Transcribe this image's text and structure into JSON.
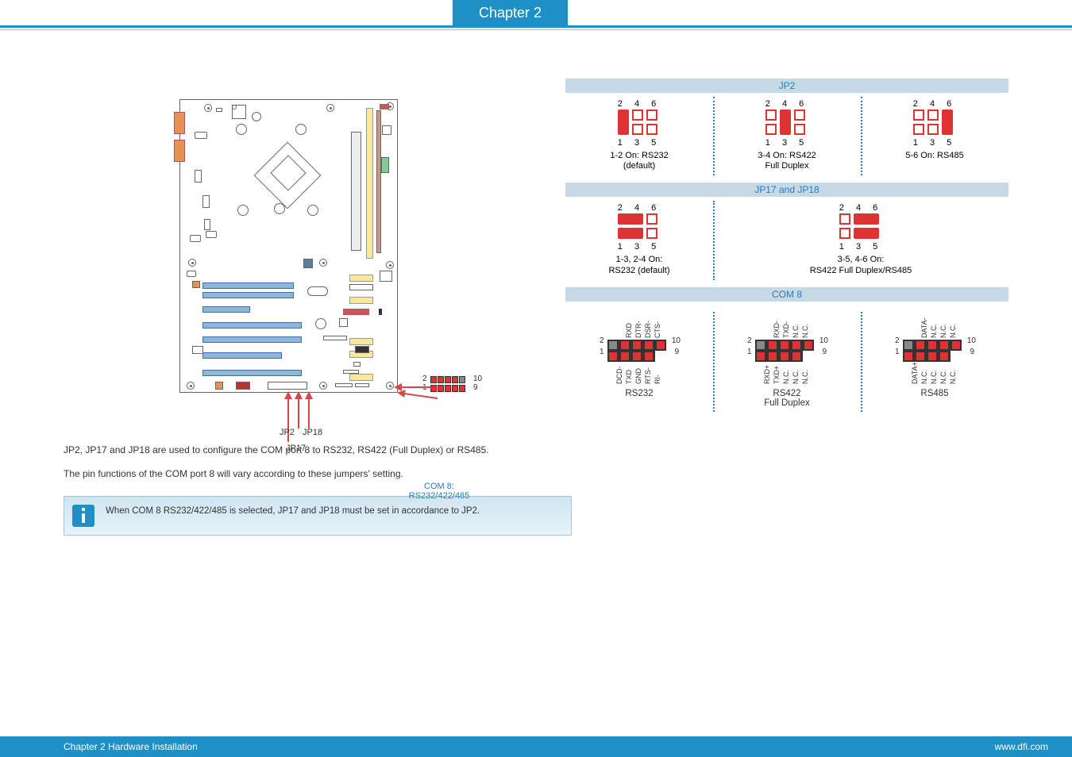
{
  "header": {
    "chapter_tab": "Chapter 2"
  },
  "footer": {
    "left": "Chapter 2 Hardware Installation",
    "right": "www.dfi.com"
  },
  "board": {
    "pin_side": {
      "two": "2",
      "one": "1",
      "ten": "10",
      "nine": "9"
    },
    "com8_label_line1": "COM 8:",
    "com8_label_line2": "RS232/422/485",
    "jp2_label": "JP2",
    "jp18_label": "JP18",
    "jp17_label": "JP17"
  },
  "jp2_panel": {
    "title": "JP2",
    "top_row": "2 4 6",
    "bot_row": "1 3 5",
    "opt1": {
      "line1": "1-2 On: RS232",
      "line2": "(default)"
    },
    "opt2": {
      "line1": "3-4 On: RS422",
      "line2": "Full Duplex"
    },
    "opt3": {
      "line1": "5-6 On: RS485"
    }
  },
  "jp17_18_panel": {
    "title": "JP17 and JP18",
    "top_row": "2 4 6",
    "bot_row": "1 3 5",
    "opt1": {
      "line1": "1-3, 2-4 On:",
      "line2": "RS232 (default)"
    },
    "opt2": {
      "line1": "3-5, 4-6 On:",
      "line2": "RS422 Full Duplex/RS485"
    }
  },
  "com8_panel": {
    "title": "COM 8",
    "side": {
      "two": "2",
      "one": "1",
      "ten": "10",
      "nine": "9"
    },
    "rs232": {
      "top": [
        "RXD",
        "DTR-",
        "DSR-",
        "CTS-"
      ],
      "bot": [
        "DCD-",
        "TXD",
        "GND",
        "RTS-",
        "RI-"
      ],
      "label": "RS232"
    },
    "rs422": {
      "top": [
        "RXD-",
        "TXD-",
        "N.C.",
        "N.C."
      ],
      "bot": [
        "RXD+",
        "TXD+",
        "N.C.",
        "N.C.",
        "N.C."
      ],
      "label_line1": "RS422",
      "label_line2": "Full Duplex"
    },
    "rs485": {
      "top": [
        "DATA-",
        "N.C.",
        "N.C.",
        "N.C."
      ],
      "bot": [
        "DATA+",
        "N.C.",
        "N.C.",
        "N.C.",
        "N.C."
      ],
      "label": "RS485"
    }
  },
  "paragraphs": {
    "p1": "JP2, JP17 and JP18 are used to configure the COM port 8 to RS232, RS422 (Full Duplex) or RS485.",
    "p2": "The pin functions of the COM port 8 will vary according to these jumpers' setting."
  },
  "note": {
    "text": "When COM 8 RS232/422/485 is selected, JP17 and JP18 must be set in accordance to JP2."
  }
}
